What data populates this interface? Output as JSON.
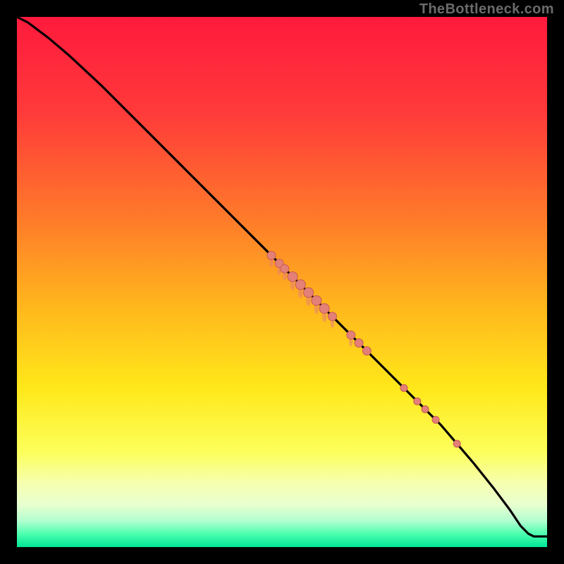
{
  "attribution": "TheBottleneck.com",
  "chart_data": {
    "type": "line",
    "title": "",
    "xlabel": "",
    "ylabel": "",
    "xlim": [
      0,
      100
    ],
    "ylim": [
      0,
      100
    ],
    "gradient_stops": [
      {
        "offset": 0,
        "color": "#ff1a3d"
      },
      {
        "offset": 18,
        "color": "#ff3a3a"
      },
      {
        "offset": 38,
        "color": "#ff7a2a"
      },
      {
        "offset": 55,
        "color": "#ffb81c"
      },
      {
        "offset": 70,
        "color": "#ffe81a"
      },
      {
        "offset": 82,
        "color": "#fcff5a"
      },
      {
        "offset": 88,
        "color": "#f6ffb0"
      },
      {
        "offset": 92,
        "color": "#e8ffcf"
      },
      {
        "offset": 95,
        "color": "#b4ffd0"
      },
      {
        "offset": 97.5,
        "color": "#4dffb0"
      },
      {
        "offset": 100,
        "color": "#00e595"
      }
    ],
    "curve": [
      {
        "x": 0.0,
        "y": 100.0
      },
      {
        "x": 2.0,
        "y": 99.0
      },
      {
        "x": 6.0,
        "y": 96.0
      },
      {
        "x": 10.0,
        "y": 92.6
      },
      {
        "x": 16.0,
        "y": 87.0
      },
      {
        "x": 24.0,
        "y": 79.0
      },
      {
        "x": 32.0,
        "y": 71.0
      },
      {
        "x": 40.0,
        "y": 63.0
      },
      {
        "x": 48.0,
        "y": 55.0
      },
      {
        "x": 56.0,
        "y": 47.0
      },
      {
        "x": 64.0,
        "y": 39.0
      },
      {
        "x": 72.0,
        "y": 31.0
      },
      {
        "x": 80.0,
        "y": 23.0
      },
      {
        "x": 86.0,
        "y": 16.0
      },
      {
        "x": 90.0,
        "y": 11.0
      },
      {
        "x": 93.0,
        "y": 7.0
      },
      {
        "x": 95.0,
        "y": 4.0
      },
      {
        "x": 96.5,
        "y": 2.5
      },
      {
        "x": 97.5,
        "y": 2.0
      },
      {
        "x": 100.0,
        "y": 2.0
      }
    ],
    "dots": [
      {
        "x": 48.0,
        "y": 55.0,
        "r": 6
      },
      {
        "x": 49.5,
        "y": 53.5,
        "r": 6
      },
      {
        "x": 50.5,
        "y": 52.5,
        "r": 6
      },
      {
        "x": 52.0,
        "y": 51.0,
        "r": 7
      },
      {
        "x": 53.5,
        "y": 49.5,
        "r": 7
      },
      {
        "x": 55.0,
        "y": 48.0,
        "r": 7
      },
      {
        "x": 56.5,
        "y": 46.5,
        "r": 7
      },
      {
        "x": 58.0,
        "y": 45.0,
        "r": 7
      },
      {
        "x": 59.5,
        "y": 43.5,
        "r": 6
      },
      {
        "x": 63.0,
        "y": 40.0,
        "r": 6
      },
      {
        "x": 64.5,
        "y": 38.5,
        "r": 6
      },
      {
        "x": 66.0,
        "y": 37.0,
        "r": 6
      },
      {
        "x": 73.0,
        "y": 30.0,
        "r": 5
      },
      {
        "x": 75.5,
        "y": 27.5,
        "r": 5
      },
      {
        "x": 77.0,
        "y": 26.0,
        "r": 5
      },
      {
        "x": 79.0,
        "y": 24.0,
        "r": 5
      },
      {
        "x": 83.0,
        "y": 19.5,
        "r": 5
      }
    ],
    "line_color": "#000000",
    "dot_fill": "#e38077",
    "dot_stroke": "#c95b52"
  }
}
